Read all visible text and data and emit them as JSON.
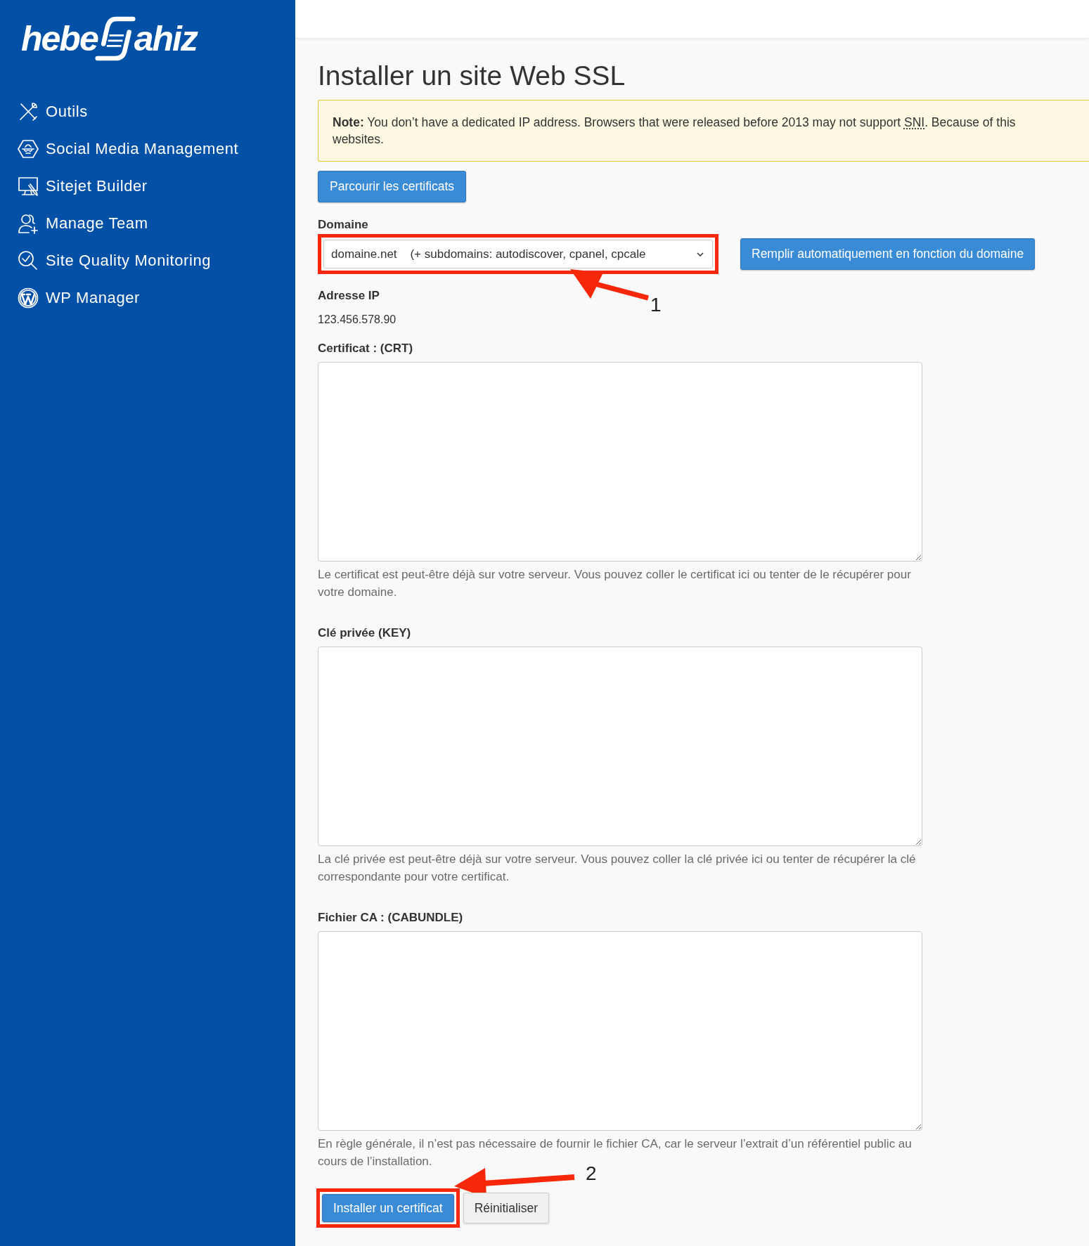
{
  "sidebar": {
    "logo": {
      "left": "hebe",
      "right": "ahiz"
    },
    "items": [
      {
        "label": "Outils",
        "selected": false
      },
      {
        "label": "Social Media Management",
        "selected": false
      },
      {
        "label": "Sitejet Builder",
        "selected": false
      },
      {
        "label": "Manage Team",
        "selected": false
      },
      {
        "label": "Site Quality Monitoring",
        "selected": false
      },
      {
        "label": "WP Manager",
        "selected": false
      }
    ]
  },
  "page": {
    "title": "Installer un site Web SSL",
    "note": {
      "label": "Note:",
      "text": "You don’t have a dedicated IP address. Browsers that were released before 2013 may not support ",
      "abbr": "SNI",
      "text_end": ". Because of this",
      "next_line": "websites."
    },
    "browse_button": "Parcourir les certificats",
    "domain": {
      "label": "Domaine",
      "value": "domaine.net    (+ subdomains: autodiscover, cpanel, cpcale",
      "highlighted": true,
      "callout": "1"
    },
    "autofill_button": "Remplir automatiquement en fonction du domaine",
    "ip": {
      "label": "Adresse IP",
      "value": "123.456.578.90"
    },
    "fields": [
      {
        "label": "Certificat : (CRT)",
        "help": "Le certificat est peut-être déjà sur votre serveur. Vous pouvez coller le certificat ici ou tenter de le récupérer pour votre domaine."
      },
      {
        "label": "Clé privée (KEY)",
        "help": "La clé privée est peut-être déjà sur votre serveur. Vous pouvez coller la clé privée ici ou tenter de récupérer la clé correspondante pour votre certificat."
      },
      {
        "label": "Fichier CA : (CABUNDLE)",
        "help": "En règle générale, il n’est pas nécessaire de fournir le fichier CA, car le serveur l’extrait d’un référentiel public au cours de l’installation."
      }
    ],
    "buttons": [
      {
        "label": "Installer un certificat",
        "kind": "primary",
        "highlighted": true,
        "callout": "2"
      },
      {
        "label": "Réinitialiser",
        "kind": "secondary",
        "highlighted": false
      }
    ]
  }
}
